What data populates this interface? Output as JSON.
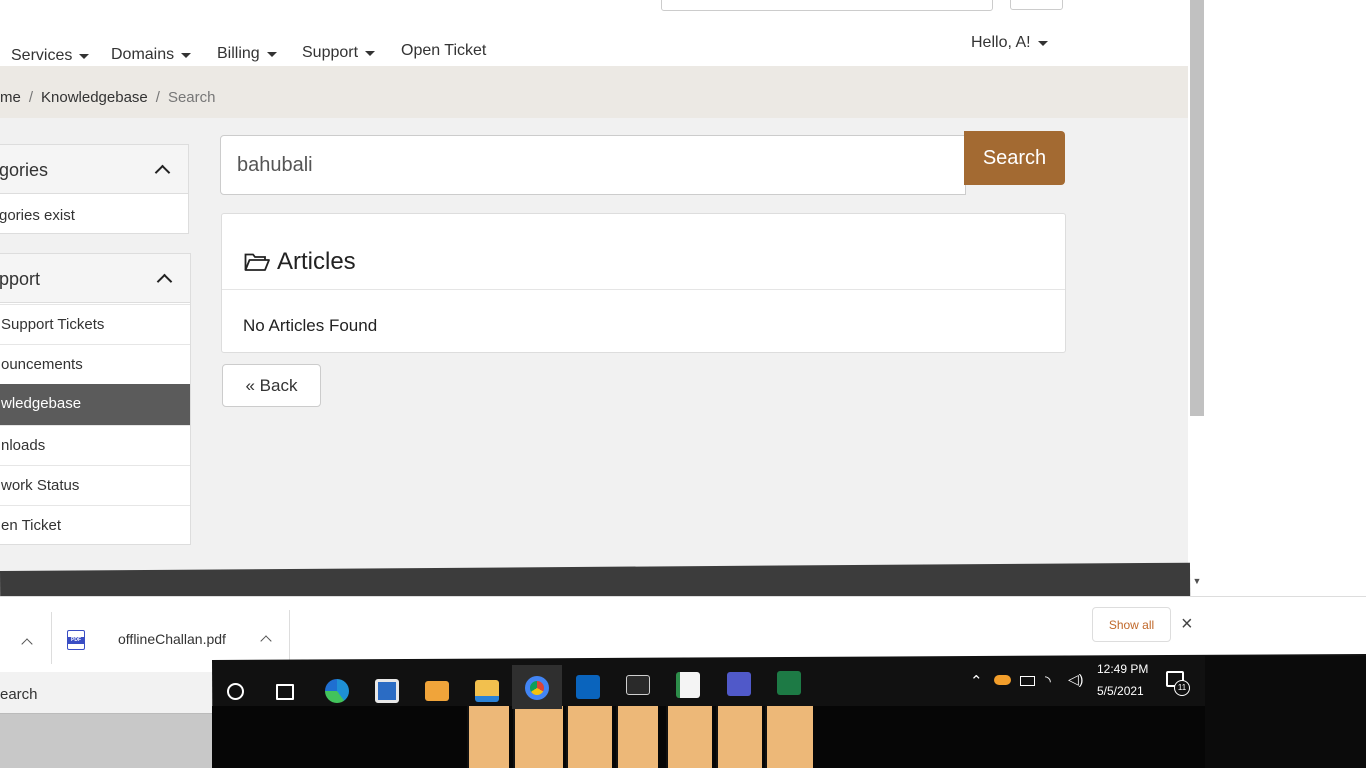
{
  "nav": {
    "items": [
      {
        "label": "Services",
        "has_caret": true
      },
      {
        "label": "Domains",
        "has_caret": true
      },
      {
        "label": "Billing",
        "has_caret": true
      },
      {
        "label": "Support",
        "has_caret": true
      },
      {
        "label": "Open Ticket",
        "has_caret": false
      }
    ],
    "user_menu": "Hello, A!"
  },
  "breadcrumb": {
    "items": [
      "me",
      "Knowledgebase",
      "Search"
    ],
    "separator": "/"
  },
  "sidebar": {
    "categories": {
      "title": "gories",
      "empty_text": "gories exist"
    },
    "support": {
      "title": "pport",
      "items": [
        {
          "label": "Support Tickets",
          "active": false
        },
        {
          "label": "ouncements",
          "active": false
        },
        {
          "label": "wledgebase",
          "active": true
        },
        {
          "label": "nloads",
          "active": false
        },
        {
          "label": "work Status",
          "active": false
        },
        {
          "label": "en Ticket",
          "active": false
        }
      ]
    }
  },
  "main": {
    "search_value": "bahubali",
    "search_button": "Search",
    "articles_title": "Articles",
    "no_results": "No Articles Found",
    "back_button": "« Back"
  },
  "downloads": {
    "file_name": "offlineChallan.pdf",
    "file_type": "PDF",
    "show_all": "Show all",
    "close": "×"
  },
  "taskbar": {
    "search_label": "earch",
    "time": "12:49 PM",
    "date": "5/5/2021",
    "notification_count": "11"
  },
  "colors": {
    "accent": "#a36a32",
    "breadcrumb_band": "#ece9e4",
    "sidebar_active": "#5b5b5b",
    "show_all_text": "#c0682a"
  }
}
